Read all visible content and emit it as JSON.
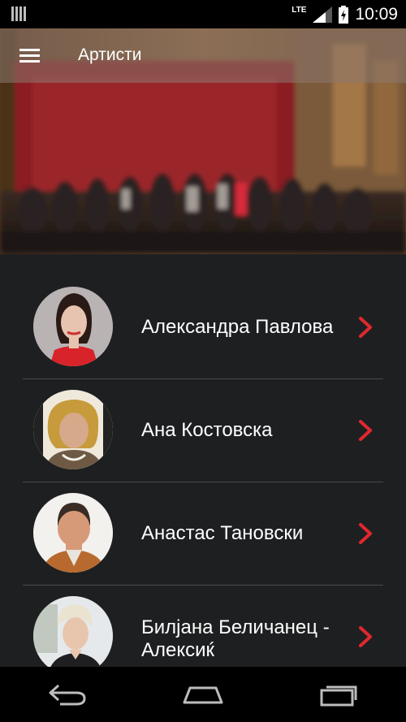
{
  "status_bar": {
    "network_label": "LTE",
    "time": "10:09"
  },
  "app_bar": {
    "title": "Артисти",
    "menu_icon": "hamburger-menu-icon"
  },
  "artists": [
    {
      "name": "Александра Павлова"
    },
    {
      "name": "Ана Костовска"
    },
    {
      "name": "Анастас Тановски"
    },
    {
      "name": "Билјана Беличанец - Алексиќ"
    }
  ],
  "colors": {
    "accent": "#e0282e",
    "list_background": "#1e1f21",
    "divider": "#4a4b4d"
  },
  "nav_bar": {
    "icons": [
      "back-icon",
      "home-icon",
      "recent-apps-icon"
    ]
  }
}
